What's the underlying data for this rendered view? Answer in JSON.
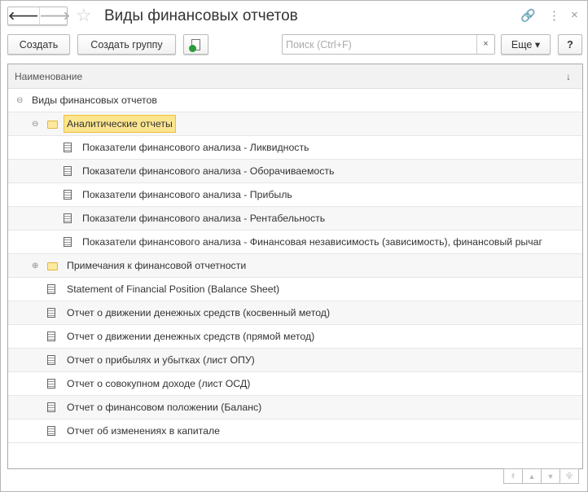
{
  "window": {
    "title": "Виды финансовых отчетов",
    "back": "🡐",
    "forward": "🡒",
    "star": "☆",
    "link": "🔗",
    "more": "⋮",
    "close": "×"
  },
  "toolbar": {
    "create": "Создать",
    "create_group": "Создать группу",
    "search_placeholder": "Поиск (Ctrl+F)",
    "search_clear": "×",
    "more": "Еще ▾",
    "help": "?"
  },
  "table": {
    "header": "Наименование",
    "sort": "↓",
    "rows": [
      {
        "text": "Виды финансовых отчетов",
        "level": 0,
        "type": "group-open"
      },
      {
        "text": "Аналитические отчеты",
        "level": 1,
        "type": "folder-open",
        "selected": true
      },
      {
        "text": "Показатели финансового анализа - Ликвидность",
        "level": 2,
        "type": "doc"
      },
      {
        "text": "Показатели финансового анализа - Оборачиваемость",
        "level": 2,
        "type": "doc"
      },
      {
        "text": "Показатели финансового анализа - Прибыль",
        "level": 2,
        "type": "doc"
      },
      {
        "text": "Показатели финансового анализа - Рентабельность",
        "level": 2,
        "type": "doc"
      },
      {
        "text": "Показатели финансового анализа - Финансовая независимость (зависимость), финансовый рычаг",
        "level": 2,
        "type": "doc"
      },
      {
        "text": "Примечания к финансовой отчетности",
        "level": 1,
        "type": "folder-closed"
      },
      {
        "text": "Statement of Financial Position (Balance Sheet)",
        "level": 1,
        "type": "doc"
      },
      {
        "text": "Отчет о движении денежных средств (косвенный метод)",
        "level": 1,
        "type": "doc"
      },
      {
        "text": "Отчет о движении денежных средств (прямой метод)",
        "level": 1,
        "type": "doc"
      },
      {
        "text": "Отчет о прибылях и убытках  (лист ОПУ)",
        "level": 1,
        "type": "doc"
      },
      {
        "text": "Отчет о совокупном доходе  (лист ОСД)",
        "level": 1,
        "type": "doc"
      },
      {
        "text": "Отчет о финансовом положении (Баланс)",
        "level": 1,
        "type": "doc"
      },
      {
        "text": "Отчет об изменениях в капитале",
        "level": 1,
        "type": "doc"
      }
    ]
  },
  "pager": [
    "⯒",
    "▲",
    "▼",
    "⯓"
  ]
}
